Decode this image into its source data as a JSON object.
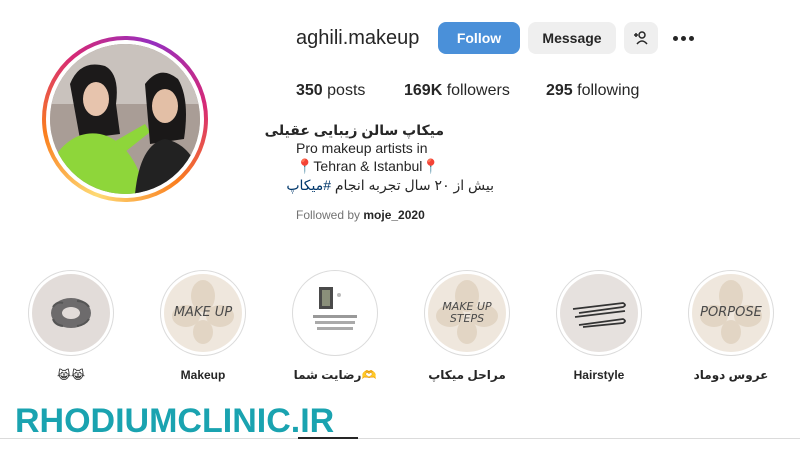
{
  "profile": {
    "username": "aghili.makeup",
    "follow_label": "Follow",
    "message_label": "Message",
    "posts_count": "350",
    "posts_label": "posts",
    "followers_count": "169K",
    "followers_label": "followers",
    "following_count": "295",
    "following_label": "following",
    "display_name": "میکاپ سالن زیبایی عقیلی",
    "bio_line1": "Pro makeup artists in",
    "bio_line2": "📍Tehran & Istanbul📍",
    "bio_line3_text": "بیش از ۲۰ سال تجربه انجام ",
    "bio_hashtag": "#میکاپ",
    "followed_by_prefix": "Followed by",
    "followed_by_user": "moje_2020"
  },
  "highlights": [
    {
      "label": "😹😹",
      "icon": "scrunchie"
    },
    {
      "label": "Makeup",
      "cover_text": "MAKE UP"
    },
    {
      "label": "رضایت شما🫶",
      "icon": "screenshot"
    },
    {
      "label": "مراحل میکاپ",
      "cover_text_1": "MAKE UP",
      "cover_text_2": "STEPS"
    },
    {
      "label": "Hairstyle",
      "icon": "hairpins"
    },
    {
      "label": "عروس دوماد",
      "cover_text": "PORPOSE"
    }
  ],
  "watermark": "RHODIUMCLINIC.IR",
  "colors": {
    "follow_button": "#4a90d9",
    "watermark": "#1aa3b0",
    "hashtag": "#00376b"
  }
}
